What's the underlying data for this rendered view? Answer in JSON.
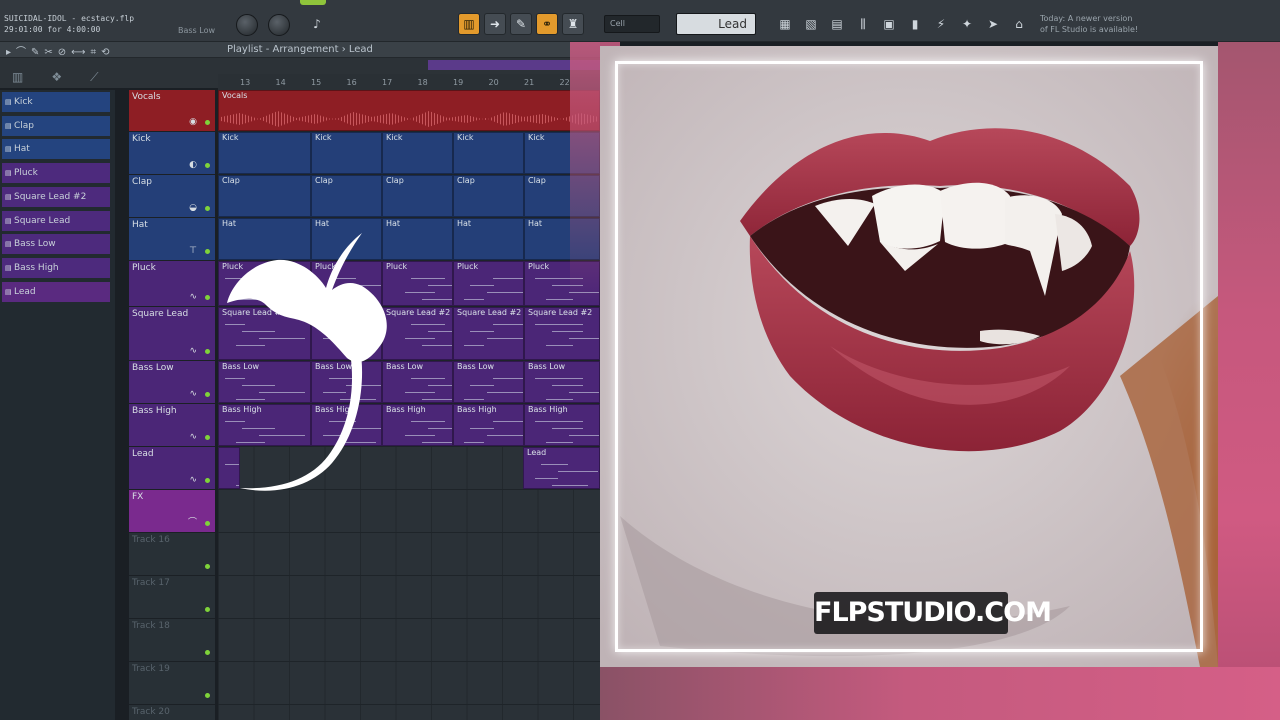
{
  "window": {
    "song_title": "SUICIDAL-IDOL - ecstacy.flp",
    "song_time": "29:01:00 for 4:00:00",
    "hint": "Bass Low"
  },
  "toolbar": {
    "snap": "Cell",
    "pattern": "Lead",
    "update_notice_line1": "Today: A newer version",
    "update_notice_line2": "of FL Studio is available!"
  },
  "playlist": {
    "breadcrumb": "Playlist - Arrangement › Lead",
    "ruler": [
      "13",
      "14",
      "15",
      "16",
      "17",
      "18",
      "19",
      "20",
      "21",
      "22"
    ]
  },
  "picker": {
    "items": [
      {
        "label": "Kick",
        "color": "#24447f"
      },
      {
        "label": "Clap",
        "color": "#24447f"
      },
      {
        "label": "Hat",
        "color": "#24447f"
      },
      {
        "label": "Pluck",
        "color": "#4d2a7d"
      },
      {
        "label": "Square Lead #2",
        "color": "#4d2a7d"
      },
      {
        "label": "Square Lead",
        "color": "#4d2a7d"
      },
      {
        "label": "Bass Low",
        "color": "#4d2a7d"
      },
      {
        "label": "Bass High",
        "color": "#4d2a7d"
      },
      {
        "label": "Lead",
        "color": "#5a2a80"
      }
    ]
  },
  "tracks": [
    {
      "name": "Vocals",
      "icon": "lips-icon",
      "glyph": "◉",
      "color": "#8e1e24",
      "clip": "Vocals"
    },
    {
      "name": "Kick",
      "icon": "kick-icon",
      "glyph": "◐",
      "color": "#243f78",
      "clip": "Kick"
    },
    {
      "name": "Clap",
      "icon": "drum-icon",
      "glyph": "◒",
      "color": "#243f78",
      "clip": "Clap"
    },
    {
      "name": "Hat",
      "icon": "cymbal-icon",
      "glyph": "⊤",
      "color": "#243f78",
      "clip": "Hat"
    },
    {
      "name": "Pluck",
      "icon": "wave-icon",
      "glyph": "∿",
      "color": "#4b2677",
      "clip": "Pluck"
    },
    {
      "name": "Square Lead",
      "icon": "wave-icon",
      "glyph": "∿",
      "color": "#4b2677",
      "clip": "Square Lead #2"
    },
    {
      "name": "Bass Low",
      "icon": "wave-icon",
      "glyph": "∿",
      "color": "#4b2677",
      "clip": "Bass Low"
    },
    {
      "name": "Bass High",
      "icon": "wave-icon",
      "glyph": "∿",
      "color": "#4b2677",
      "clip": "Bass High"
    },
    {
      "name": "Lead",
      "icon": "wave-icon",
      "glyph": "∿",
      "color": "#4b2677",
      "clip": "Lead"
    },
    {
      "name": "FX",
      "icon": "fx-icon",
      "glyph": "⌒",
      "color": "#7a2a8e",
      "clip": ""
    },
    {
      "name": "Track 16",
      "icon": "",
      "glyph": "",
      "color": "#283036",
      "clip": ""
    },
    {
      "name": "Track 17",
      "icon": "",
      "glyph": "",
      "color": "#283036",
      "clip": ""
    },
    {
      "name": "Track 18",
      "icon": "",
      "glyph": "",
      "color": "#283036",
      "clip": ""
    },
    {
      "name": "Track 19",
      "icon": "",
      "glyph": "",
      "color": "#283036",
      "clip": ""
    },
    {
      "name": "Track 20",
      "icon": "",
      "glyph": "",
      "color": "#283036",
      "clip": ""
    }
  ],
  "cover": {
    "brand": "FLPSTUDIO.COM"
  }
}
